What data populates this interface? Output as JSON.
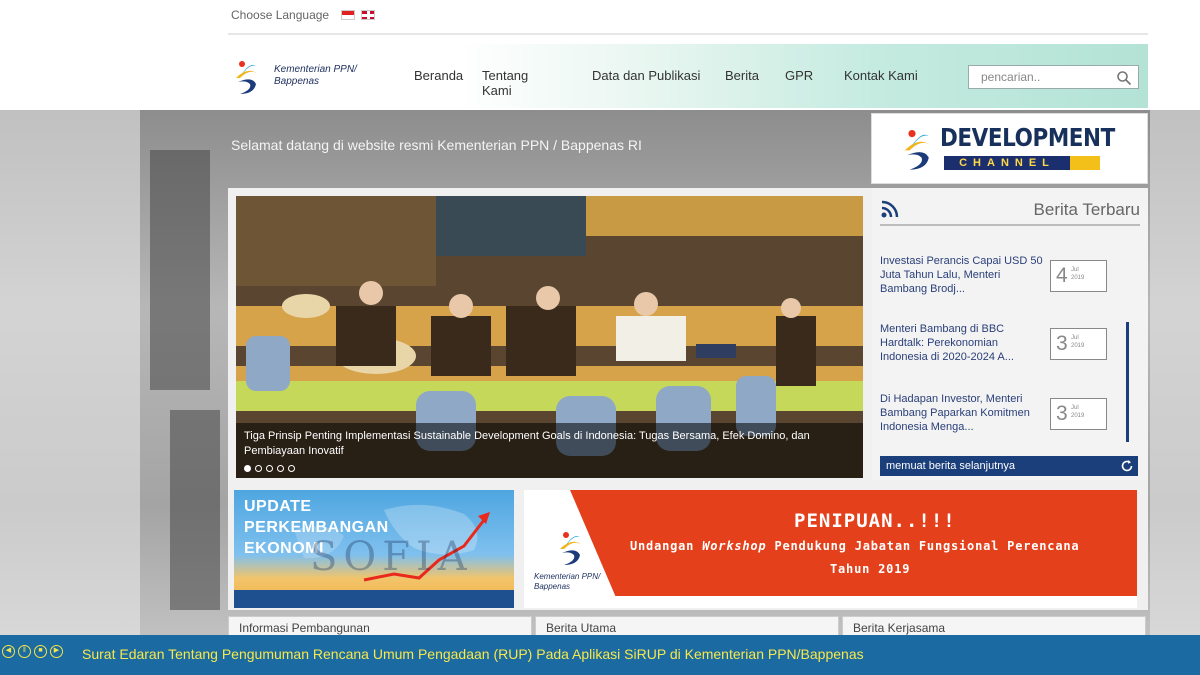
{
  "language": {
    "label": "Choose Language"
  },
  "header": {
    "logo_line1": "Kementerian PPN/",
    "logo_line2": "Bappenas",
    "nav": [
      "Beranda",
      "Tentang Kami",
      "Data dan Publikasi",
      "Berita",
      "GPR",
      "Kontak Kami"
    ],
    "search_placeholder": "pencarian.."
  },
  "welcome": "Selamat datang di website resmi Kementerian PPN / Bappenas RI",
  "dev_channel": {
    "title": "DEVELOPMENT",
    "subtitle": "CHANNEL"
  },
  "hero": {
    "caption": "Tiga Prinsip Penting Implementasi Sustainable Development Goals di Indonesia: Tugas Bersama, Efek Domino, dan Pembiayaan Inovatif",
    "slide_count": 5,
    "active_slide": 1
  },
  "news": {
    "title": "Berita Terbaru",
    "items": [
      {
        "text": "Investasi Perancis Capai USD 50 Juta Tahun Lalu, Menteri Bambang Brodj...",
        "day": "4",
        "month": "Jul",
        "year": "2019"
      },
      {
        "text": "Menteri Bambang di BBC Hardtalk: Perekonomian Indonesia di 2020-2024 A...",
        "day": "3",
        "month": "Jul",
        "year": "2019"
      },
      {
        "text": "Di Hadapan Investor, Menteri Bambang Paparkan Komitmen Indonesia Menga...",
        "day": "3",
        "month": "Jul",
        "year": "2019"
      }
    ],
    "load_more": "memuat berita selanjutnya"
  },
  "banner_left": {
    "line1": "UPDATE",
    "line2": "PERKEMBANGAN",
    "line3": "EKONOMI",
    "watermark": "SOFIA"
  },
  "banner_right": {
    "title": "PENIPUAN..!!!",
    "line1_a": "Undangan ",
    "line1_b": "Workshop",
    "line1_c": " Pendukung Jabatan Fungsional Perencana",
    "line2": "Tahun 2019",
    "logo_line1": "Kementerian PPN/",
    "logo_line2": "Bappenas"
  },
  "bottom_tabs": [
    "Informasi Pembangunan",
    "Berita Utama",
    "Berita Kerjasama"
  ],
  "ticker": "Surat Edaran Tentang Pengumuman Rencana Umum Pengadaan (RUP) Pada Aplikasi SiRUP di Kementerian PPN/Bappenas",
  "colors": {
    "navy": "#1a3f7a",
    "accent_red": "#e5401c",
    "ticker_bg": "#1b6aa1",
    "ticker_text": "#f7e84b"
  }
}
